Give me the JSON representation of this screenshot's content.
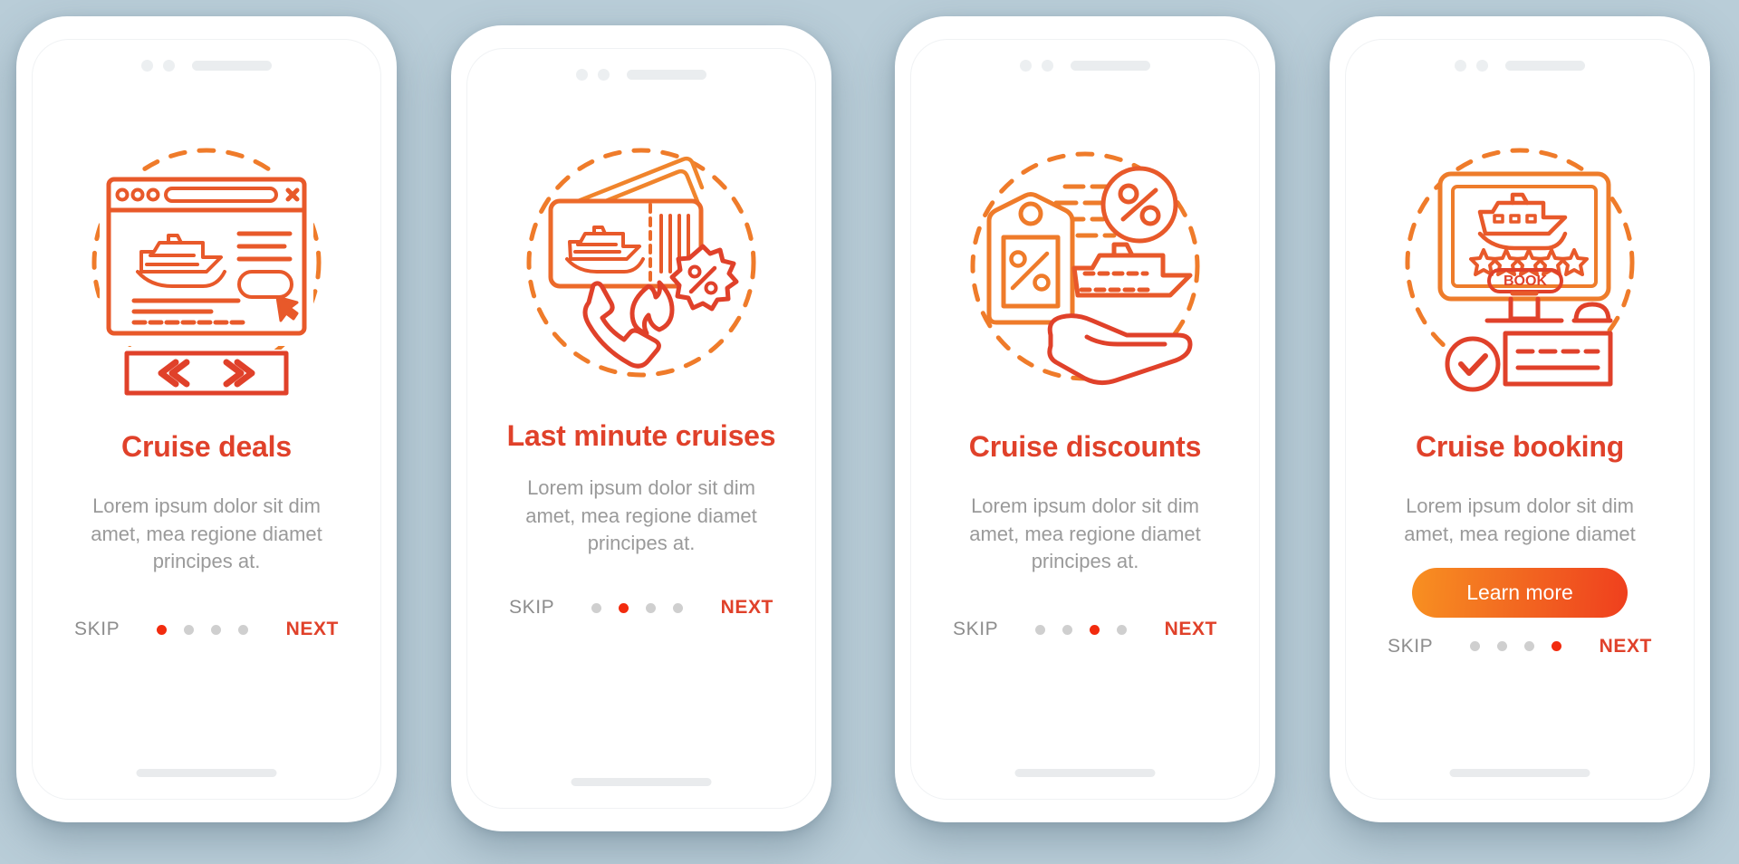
{
  "background_color": "#b9cdd8",
  "theme": {
    "title_color": "#e0412a",
    "body_color": "#9a9a9a",
    "accent_gradient_from": "#f89021",
    "accent_gradient_to": "#ef3f1e",
    "active_dot_color": "#f22b0e",
    "inactive_dot_color": "#cfcfcf"
  },
  "screens": [
    {
      "id": "cruise-deals",
      "illustration": "browser-cruise-search-icon",
      "title": "Cruise deals",
      "description": "Lorem ipsum dolor sit dim amet, mea regione diamet principes at.",
      "skip_label": "SKIP",
      "next_label": "NEXT",
      "cta_label": null,
      "dots": 4,
      "active_dot": 1
    },
    {
      "id": "last-minute-cruises",
      "illustration": "ticket-fire-phone-icon",
      "title": "Last minute cruises",
      "description": "Lorem ipsum dolor sit dim amet, mea regione diamet principes at.",
      "skip_label": "SKIP",
      "next_label": "NEXT",
      "cta_label": null,
      "dots": 4,
      "active_dot": 2
    },
    {
      "id": "cruise-discounts",
      "illustration": "price-tag-percent-ship-icon",
      "title": "Cruise discounts",
      "description": "Lorem ipsum dolor sit dim amet, mea regione diamet principes at.",
      "skip_label": "SKIP",
      "next_label": "NEXT",
      "cta_label": null,
      "dots": 4,
      "active_dot": 3
    },
    {
      "id": "cruise-booking",
      "illustration": "monitor-booking-icon",
      "title": "Cruise booking",
      "description": "Lorem ipsum dolor sit dim amet, mea regione diamet",
      "skip_label": "SKIP",
      "next_label": "NEXT",
      "cta_label": "Learn more",
      "dots": 4,
      "active_dot": 4
    }
  ],
  "illustration_text": {
    "book_button": "BOOK",
    "percent_symbol": "%"
  }
}
